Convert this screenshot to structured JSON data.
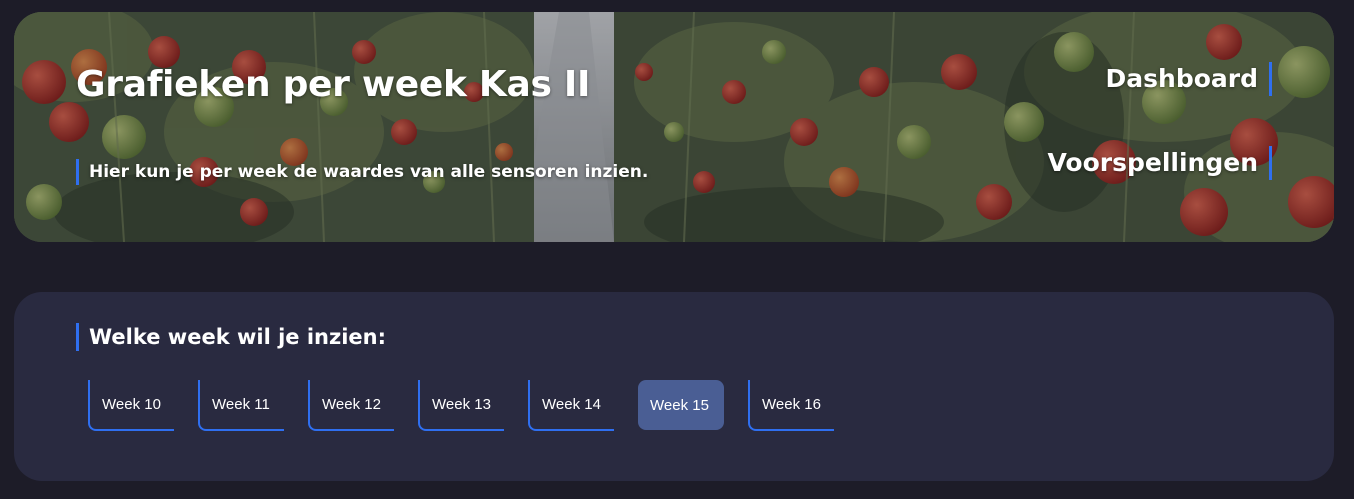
{
  "header": {
    "title": "Grafieken per week Kas II",
    "subtitle": "Hier kun je per week de waardes van alle sensoren inzien."
  },
  "nav": {
    "items": [
      {
        "label": "Dashboard"
      },
      {
        "label": "Voorspellingen"
      }
    ]
  },
  "week_picker": {
    "heading": "Welke week wil je inzien:",
    "weeks": [
      {
        "label": "Week 10"
      },
      {
        "label": "Week 11"
      },
      {
        "label": "Week 12"
      },
      {
        "label": "Week 13"
      },
      {
        "label": "Week 14"
      },
      {
        "label": "Week 15",
        "selected": true
      },
      {
        "label": "Week 16"
      }
    ]
  },
  "colors": {
    "page_background": "#1d1c28",
    "panel_background": "#292a40",
    "accent": "#2f6ff0",
    "selected_week": "#4a5e94",
    "text": "#ffffff"
  },
  "hero_image": {
    "subject": "greenhouse-tomato-rows"
  }
}
